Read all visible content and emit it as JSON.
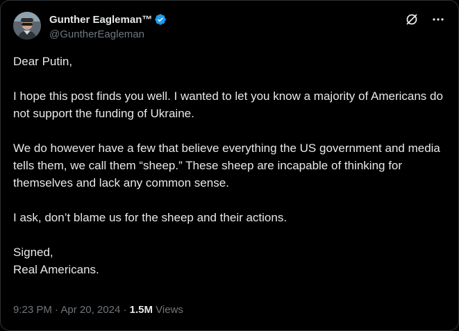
{
  "author": {
    "display_name": "Gunther Eagleman™",
    "handle": "@GuntherEagleman",
    "verified_badge_icon": "verified-badge-icon",
    "verified_color": "#1d9bf0"
  },
  "header_icons": [
    "grok-icon",
    "more-icon"
  ],
  "post": {
    "greeting": "Dear Putin,",
    "paragraph_1": "I hope this post finds you well.  I wanted to let you know a majority of Americans do not support the funding of Ukraine.",
    "paragraph_2": "We do however have a few that believe everything the US government and media tells them, we call them “sheep.” These sheep are incapable of thinking for themselves and lack any common sense.",
    "paragraph_3": "I ask, don’t blame us for the sheep and their actions.",
    "signoff_line_1": "Signed,",
    "signoff_line_2": "Real Americans."
  },
  "meta": {
    "time": "9:23 PM",
    "separator": "·",
    "date": "Apr 20, 2024",
    "views_count": "1.5M",
    "views_label": "Views"
  },
  "colors": {
    "background": "#000000",
    "text_primary": "#e7e9ea",
    "text_secondary": "#71767b",
    "border": "#2f3336"
  }
}
